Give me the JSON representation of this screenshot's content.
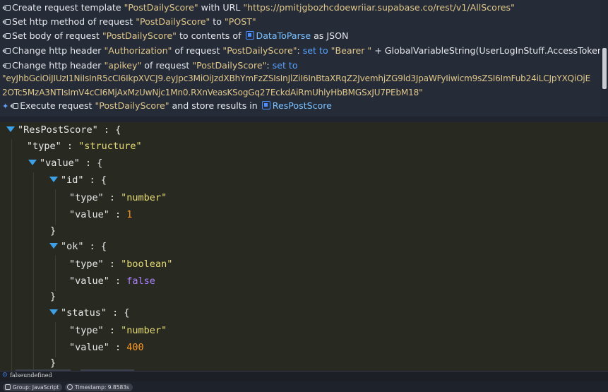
{
  "actions": {
    "line1": {
      "text1": "Create request template ",
      "q1": "\"PostDailyScore\"",
      "text2": " with URL ",
      "q2": "\"https://pmitjgbozhcdoewriiar.supabase.co/rest/v1/AllScores\""
    },
    "line2": {
      "text1": "Set http method of request ",
      "q1": "\"PostDailyScore\"",
      "text2": " to ",
      "q2": "\"POST\""
    },
    "line3": {
      "text1": "Set body of request ",
      "q1": "\"PostDailyScore\"",
      "text2": " to contents of ",
      "var": "DataToParse",
      "text3": " as JSON"
    },
    "line4": {
      "text1": "Change http header ",
      "q1": "\"Authorization\"",
      "text2": " of request ",
      "q2": "\"PostDailyScore\"",
      "text3": ": ",
      "kw": "set to",
      "text4": " ",
      "q3": "\"Bearer \"",
      "text5": " + GlobalVariableString(UserLogInStuff.AccessToken)"
    },
    "line5": {
      "text1": "Change http header ",
      "q1": "\"apikey\"",
      "text2": " of request ",
      "q2": "\"PostDailyScore\"",
      "text3": ": ",
      "kw": "set to"
    },
    "line5b": {
      "token": "\"eyJhbGciOiJIUzI1NiIsInR5cCI6IkpXVCJ9.eyJpc3MiOiJzdXBhYmFzZSIsInJlZiI6InBtaXRqZ2JvemhjZG9ld3JpaWFyIiwicm9sZSI6ImFub24iLCJpYXQiOjE2OTc5MzA3NTIsImV4cCI6MjAxMzUwNjc1Mn0.RXnVeasKSogGq27EckdAiRmUhlyHbBMGSxJU7PEbM18\""
    },
    "line6": {
      "text1": "Execute request ",
      "q1": "\"PostDailyScore\"",
      "text2": " and store results in ",
      "var": "ResPostScore"
    }
  },
  "json": {
    "root_key": "\"ResPostScore\"",
    "type_key": "\"type\"",
    "type_val": "\"structure\"",
    "value_key": "\"value\"",
    "id_key": "\"id\"",
    "id_type_key": "\"type\"",
    "id_type": "\"number\"",
    "id_value_key": "\"value\"",
    "id_value": "1",
    "ok_key": "\"ok\"",
    "ok_type_key": "\"type\"",
    "ok_type": "\"boolean\"",
    "ok_value_key": "\"value\"",
    "ok_value": "false",
    "status_key": "\"status\"",
    "status_type_key": "\"type\"",
    "status_type": "\"number\"",
    "status_value_key": "\"value\"",
    "status_value": "400",
    "colon": " : ",
    "open": "{",
    "close": "}"
  },
  "console": {
    "text": "falseundefined"
  },
  "badges": {
    "group": "Group: JavaScript",
    "timestamp": "Timestamp: 9.8583s"
  },
  "colors": {
    "accent": "#4a90ff",
    "string": "#e6db74",
    "number": "#fd971f",
    "boolean": "#ae81ff"
  }
}
